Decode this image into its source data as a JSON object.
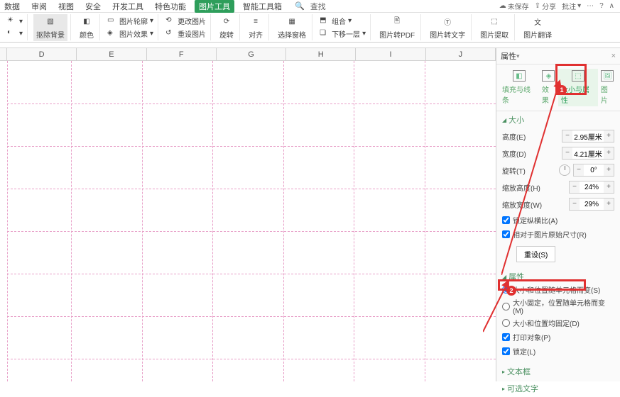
{
  "menu": {
    "tabs": [
      "数据",
      "审阅",
      "视图",
      "安全",
      "开发工具",
      "特色功能",
      "图片工具",
      "智能工具箱"
    ],
    "active_index": 6,
    "search": "查找",
    "right": {
      "unsaved": "未保存",
      "share": "分享",
      "comment": "批注"
    }
  },
  "ribbon": {
    "remove_bg": "抠除背景",
    "color": "颜色",
    "outline": "图片轮廓",
    "effect": "图片效果",
    "reset": "重设图片",
    "change": "更改图片",
    "rotate": "旋转",
    "align": "对齐",
    "combine": "组合",
    "select_pane": "选择窗格",
    "move": "下移一层",
    "to_pdf": "图片转PDF",
    "to_text": "图片转文字",
    "extract": "图片提取",
    "translate": "图片翻译"
  },
  "columns": [
    "D",
    "E",
    "F",
    "G",
    "H",
    "I",
    "J"
  ],
  "panel": {
    "title": "属性",
    "tabs": {
      "fill": "填充与线条",
      "effect": "效果",
      "size_prop": "大小与属性",
      "image": "图片"
    },
    "active_tab": 2,
    "size": {
      "title": "大小",
      "height_lbl": "高度(E)",
      "height_val": "2.95厘米",
      "width_lbl": "宽度(D)",
      "width_val": "4.21厘米",
      "rotate_lbl": "旋转(T)",
      "rotate_val": "0°",
      "scale_h_lbl": "缩放高度(H)",
      "scale_h_val": "24%",
      "scale_w_lbl": "缩放宽度(W)",
      "scale_w_val": "29%",
      "lock_ratio": "锁定纵横比(A)",
      "relative_orig": "相对于图片原始尺寸(R)",
      "reset_btn": "重设(S)"
    },
    "props": {
      "title": "属性",
      "opt_move_size": "大小和位置随单元格而变(S)",
      "opt_move_only": "大小固定，位置随单元格而变(M)",
      "opt_fixed": "大小和位置均固定(D)",
      "print": "打印对象(P)",
      "locked": "锁定(L)"
    },
    "textbox": "文本框",
    "alt_text": "可选文字"
  },
  "annotations": {
    "n1": "1",
    "n2": "2"
  }
}
